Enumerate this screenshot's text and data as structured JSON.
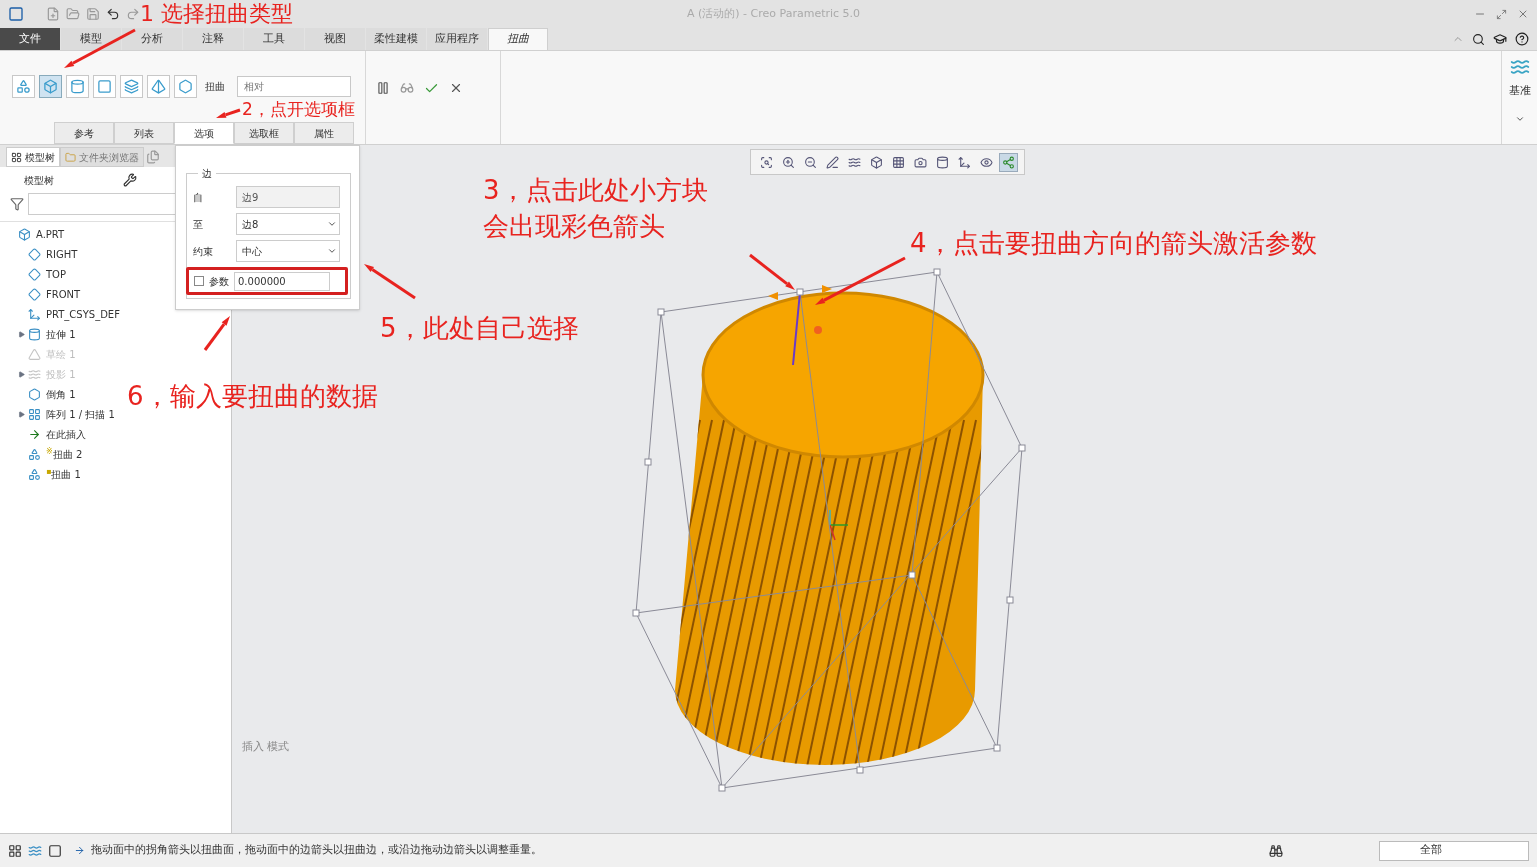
{
  "window": {
    "title": "A (活动的) - Creo Parametric 5.0"
  },
  "ribbon_tabs": [
    {
      "label": "文件",
      "kind": "file",
      "selected": false
    },
    {
      "label": "模型",
      "kind": "tab",
      "selected": false
    },
    {
      "label": "分析",
      "kind": "tab",
      "selected": false
    },
    {
      "label": "注释",
      "kind": "tab",
      "selected": false
    },
    {
      "label": "工具",
      "kind": "tab",
      "selected": false
    },
    {
      "label": "视图",
      "kind": "tab",
      "selected": false
    },
    {
      "label": "柔性建模",
      "kind": "tab",
      "selected": false
    },
    {
      "label": "应用程序",
      "kind": "tab",
      "selected": false
    },
    {
      "label": "扭曲",
      "kind": "tab",
      "selected": true
    }
  ],
  "ribbon": {
    "type_buttons": [
      {
        "selected": false
      },
      {
        "selected": true
      },
      {
        "selected": false
      },
      {
        "selected": false
      },
      {
        "selected": false
      },
      {
        "selected": false
      },
      {
        "selected": false
      }
    ],
    "type_label": "扭曲",
    "mode_dropdown": "相对",
    "sub_tabs": [
      {
        "label": "参考",
        "selected": false
      },
      {
        "label": "列表",
        "selected": false
      },
      {
        "label": "选项",
        "selected": true
      },
      {
        "label": "选取框",
        "selected": false
      },
      {
        "label": "属性",
        "selected": false
      }
    ],
    "datum_label": "基准"
  },
  "options_panel": {
    "group_title": "边",
    "fields": [
      {
        "label": "自",
        "value": "边9",
        "kind": "readonly"
      },
      {
        "label": "至",
        "value": "边8",
        "kind": "dropdown"
      },
      {
        "label": "约束",
        "value": "中心",
        "kind": "dropdown"
      }
    ],
    "parameter": {
      "label": "参数",
      "checked": false,
      "value": "0.000000"
    }
  },
  "model_tree": {
    "tabs": [
      {
        "label": "模型树",
        "selected": true
      },
      {
        "label": "文件夹浏览器",
        "selected": false
      }
    ],
    "header": "模型树",
    "items": [
      {
        "label": "A.PRT",
        "kind": "part",
        "collapsed": false,
        "disabled": false,
        "children": [
          {
            "label": "RIGHT",
            "kind": "plane",
            "collapsed": false,
            "disabled": false
          },
          {
            "label": "TOP",
            "kind": "plane",
            "collapsed": false,
            "disabled": false
          },
          {
            "label": "FRONT",
            "kind": "plane",
            "collapsed": false,
            "disabled": false
          },
          {
            "label": "PRT_CSYS_DEF",
            "kind": "csys",
            "collapsed": false,
            "disabled": false
          },
          {
            "label": "拉伸 1",
            "kind": "extrude",
            "collapsed": true,
            "disabled": false
          },
          {
            "label": "草绘 1",
            "kind": "sketch",
            "collapsed": false,
            "disabled": true
          },
          {
            "label": "投影 1",
            "kind": "projection",
            "collapsed": true,
            "disabled": true
          },
          {
            "label": "倒角 1",
            "kind": "chamfer",
            "collapsed": false,
            "disabled": false
          },
          {
            "label": "阵列 1 / 扫描 1",
            "kind": "pattern",
            "collapsed": true,
            "disabled": false
          },
          {
            "label": "在此插入",
            "kind": "insert",
            "collapsed": false,
            "disabled": false
          },
          {
            "label": "扭曲 2",
            "marker": "※",
            "kind": "warp",
            "collapsed": false,
            "disabled": false
          },
          {
            "label": "扭曲 1",
            "marker": "▪",
            "kind": "warp",
            "collapsed": false,
            "disabled": false
          }
        ]
      }
    ]
  },
  "view_tools": [
    {
      "active": false
    },
    {
      "active": false
    },
    {
      "active": false
    },
    {
      "active": false
    },
    {
      "active": false
    },
    {
      "active": false
    },
    {
      "active": false
    },
    {
      "active": false
    },
    {
      "active": false
    },
    {
      "active": false
    },
    {
      "active": false
    },
    {
      "active": true
    }
  ],
  "viewport": {
    "mode_text": "插入 模式"
  },
  "status_bar": {
    "message": "拖动面中的拐角箭头以扭曲面，拖动面中的边箭头以扭曲边，或沿边拖动边箭头以调整垂量。",
    "filter": "全部"
  },
  "annotations": [
    {
      "lines": [
        "1 选择扭曲类型"
      ]
    },
    {
      "lines": [
        "2，点开选项框"
      ]
    },
    {
      "lines": [
        "3，点击此处小方块",
        "会出现彩色箭头"
      ]
    },
    {
      "lines": [
        "4，点击要扭曲方向的箭头激活参数"
      ]
    },
    {
      "lines": [
        "5，此处自己选择"
      ]
    },
    {
      "lines": [
        "6，输入要扭曲的数据"
      ]
    }
  ]
}
